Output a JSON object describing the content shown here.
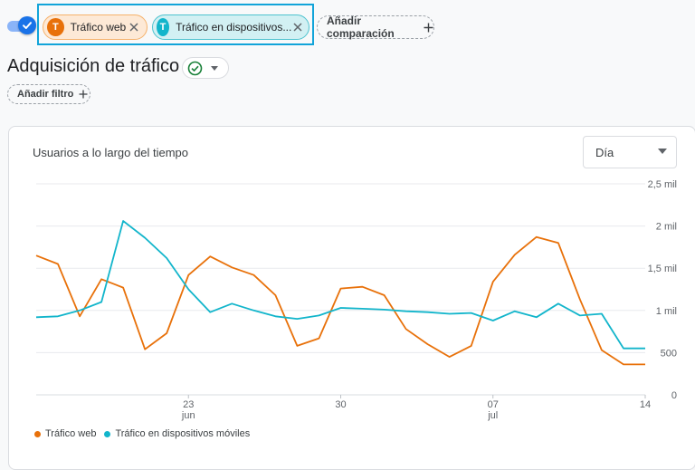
{
  "compare": {
    "toggle_state": "on",
    "chips": [
      {
        "initial": "T",
        "label": "Tráfico web",
        "color": "#e8710a"
      },
      {
        "initial": "T",
        "label": "Tráfico en dispositivos...",
        "color": "#12b5cb"
      }
    ],
    "add_label": "Añadir comparación"
  },
  "header": {
    "title": "Adquisición de tráfico",
    "add_filter_label": "Añadir filtro"
  },
  "card": {
    "title": "Usuarios a lo largo del tiempo",
    "period_value": "Día"
  },
  "chart_data": {
    "type": "line",
    "x": [
      "16 jun",
      "17 jun",
      "18 jun",
      "19 jun",
      "20 jun",
      "21 jun",
      "22 jun",
      "23 jun",
      "24 jun",
      "25 jun",
      "26 jun",
      "27 jun",
      "28 jun",
      "29 jun",
      "30 jun",
      "1 jul",
      "2 jul",
      "3 jul",
      "4 jul",
      "5 jul",
      "6 jul",
      "7 jul",
      "8 jul",
      "9 jul",
      "10 jul",
      "11 jul",
      "12 jul",
      "13 jul",
      "14 jul"
    ],
    "x_tick_labels": [
      {
        "day": "23",
        "month": "jun",
        "index": 7
      },
      {
        "day": "30",
        "month": "",
        "index": 14
      },
      {
        "day": "07",
        "month": "jul",
        "index": 21
      },
      {
        "day": "14",
        "month": "",
        "index": 28
      }
    ],
    "y_tick_labels": [
      "0",
      "500",
      "1 mil",
      "1,5 mil",
      "2 mil",
      "2,5 mil"
    ],
    "ylim": [
      0,
      2500
    ],
    "series": [
      {
        "name": "Tráfico web",
        "color": "#e8710a",
        "values": [
          1650,
          1550,
          930,
          1370,
          1270,
          540,
          730,
          1420,
          1640,
          1510,
          1420,
          1180,
          580,
          670,
          1260,
          1280,
          1180,
          780,
          600,
          450,
          580,
          1340,
          1660,
          1870,
          1800,
          1130,
          530,
          360,
          360
        ]
      },
      {
        "name": "Tráfico en dispositivos móviles",
        "color": "#12b5cb",
        "values": [
          920,
          930,
          1000,
          1100,
          2060,
          1860,
          1620,
          1250,
          980,
          1080,
          1000,
          930,
          900,
          940,
          1030,
          1020,
          1010,
          990,
          980,
          960,
          970,
          880,
          990,
          920,
          1080,
          940,
          960,
          550,
          550
        ]
      }
    ]
  }
}
